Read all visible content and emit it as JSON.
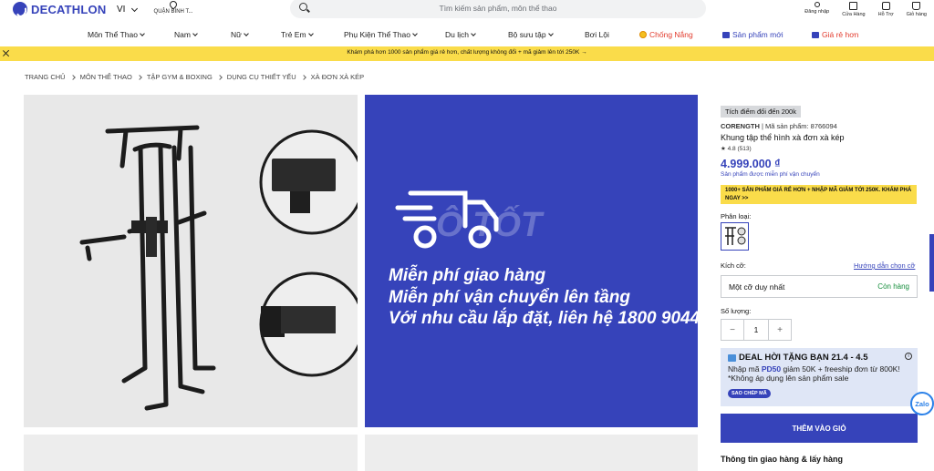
{
  "header": {
    "logo": "DECATHLON",
    "language": "VI",
    "location": "QUẬN BÌNH T...",
    "search_placeholder": "Tìm kiếm sản phẩm, môn thể thao",
    "account": [
      {
        "label": "Đăng nhập",
        "icon": "user-icon"
      },
      {
        "label": "Cửa Hàng",
        "icon": "store-icon"
      },
      {
        "label": "Hỗ Trợ",
        "icon": "chat-icon"
      },
      {
        "label": "Giỏ hàng",
        "icon": "bag-icon"
      }
    ]
  },
  "nav": [
    {
      "label": "Môn Thể Thao"
    },
    {
      "label": "Nam"
    },
    {
      "label": "Nữ"
    },
    {
      "label": "Trẻ Em"
    },
    {
      "label": "Phụ Kiện Thể Thao"
    },
    {
      "label": "Du lịch"
    },
    {
      "label": "Bộ sưu tập"
    },
    {
      "label": "Bơi Lội"
    },
    {
      "label": "Chống Nắng"
    },
    {
      "label": "Sản phẩm mới"
    },
    {
      "label": "Giá rẻ hơn"
    }
  ],
  "promo": {
    "text": "Khám phá hơn 1000 sản phẩm giá rẻ hơn, chất lượng không đổi + mã giảm lên tới 250K →"
  },
  "breadcrumb": [
    "TRANG CHỦ",
    "MÔN THỂ THAO",
    "TẬP GYM & BOXING",
    "DỤNG CỤ THIẾT YẾU",
    "XÀ ĐƠN XÀ KÉP"
  ],
  "gallery": {
    "shipping_lines": [
      "Miễn phí giao hàng",
      "Miễn phí vận chuyển lên tầng",
      "Với nhu cầu lắp đặt, liên hệ 1800 9044"
    ],
    "watermark": "Ô TỐT"
  },
  "product": {
    "badge": "Tích điểm đổi đến 200k",
    "brand": "CORENGTH",
    "sku_label": "| Mã sản phẩm: 8766094",
    "name": "Khung tập thể hình xà đơn xà kép",
    "rating": "★ 4.8  (513)",
    "price": "4.999.000 ₫",
    "free_ship": "Sản phẩm được miễn phí vận chuyển",
    "promo_box": "1000+ SẢN PHẨM GIÁ RẺ HƠN + NHẬP MÃ GIẢM TỚI 250K. KHÁM PHÁ NGAY >>",
    "variant_label": "Phân loại:",
    "size_label": "Kích cỡ:",
    "size_guide": "Hướng dẫn chọn cỡ",
    "size_value": "Một cỡ duy nhất",
    "stock": "Còn hàng",
    "qty_label": "Số lượng:",
    "qty_minus": "−",
    "qty_value": "1",
    "qty_plus": "+",
    "deal_title": "DEAL HỜI TẶNG BẠN 21.4 - 4.5",
    "deal_pre": "Nhập mã ",
    "deal_code": "PD50",
    "deal_post": " giảm 50K + freeship đơn từ 800K! *Không áp dụng lên sản phẩm sale",
    "copy_label": "SAO CHÉP MÃ",
    "add_to_cart": "THÊM VÀO GIỎ",
    "delivery_title": "Thông tin giao hàng & lấy hàng"
  },
  "widgets": {
    "zalo": "Zalo"
  },
  "colors": {
    "brand": "#3643ba",
    "promo": "#fadc4a",
    "in_stock": "#148d3b"
  }
}
